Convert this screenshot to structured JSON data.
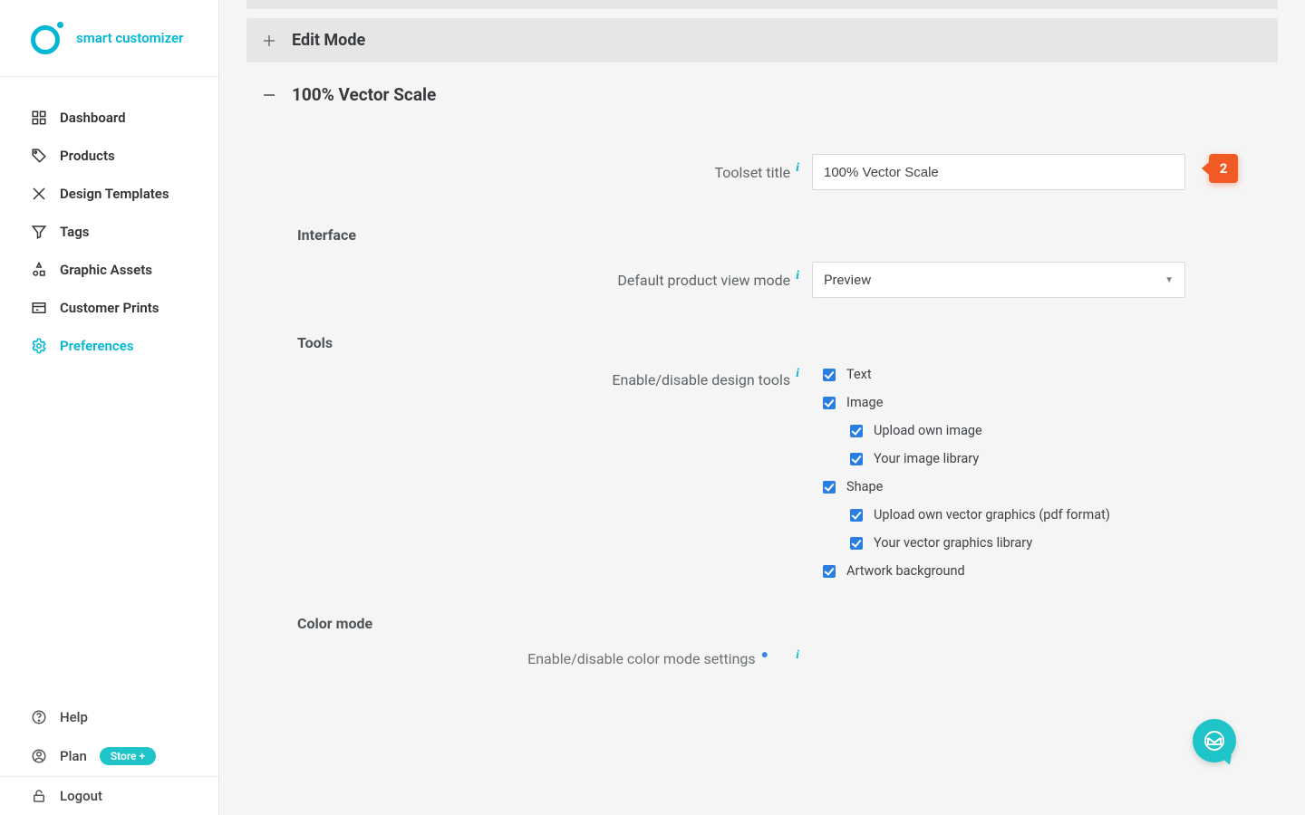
{
  "brand": {
    "name": "smart customizer"
  },
  "sidebar": {
    "items": [
      {
        "label": "Dashboard"
      },
      {
        "label": "Products"
      },
      {
        "label": "Design Templates"
      },
      {
        "label": "Tags"
      },
      {
        "label": "Graphic Assets"
      },
      {
        "label": "Customer Prints"
      },
      {
        "label": "Preferences"
      }
    ],
    "bottom": {
      "help": "Help",
      "plan_label": "Plan",
      "plan_badge": "Store +",
      "logout": "Logout"
    }
  },
  "accordion": {
    "edit_mode": "Edit Mode",
    "vector_scale": "100% Vector Scale"
  },
  "form": {
    "toolset_title_label": "Toolset title",
    "toolset_title_value": "100% Vector Scale",
    "step_badge": "2",
    "interface_header": "Interface",
    "view_mode_label": "Default product view mode",
    "view_mode_value": "Preview",
    "tools_header": "Tools",
    "design_tools_label": "Enable/disable design tools",
    "tools": {
      "text": "Text",
      "image": "Image",
      "image_upload": "Upload own image",
      "image_library": "Your image library",
      "shape": "Shape",
      "shape_upload": "Upload own vector graphics (pdf format)",
      "shape_library": "Your vector graphics library",
      "artwork_bg": "Artwork background"
    },
    "color_mode_header": "Color mode",
    "color_mode_label": "Enable/disable color mode settings"
  }
}
